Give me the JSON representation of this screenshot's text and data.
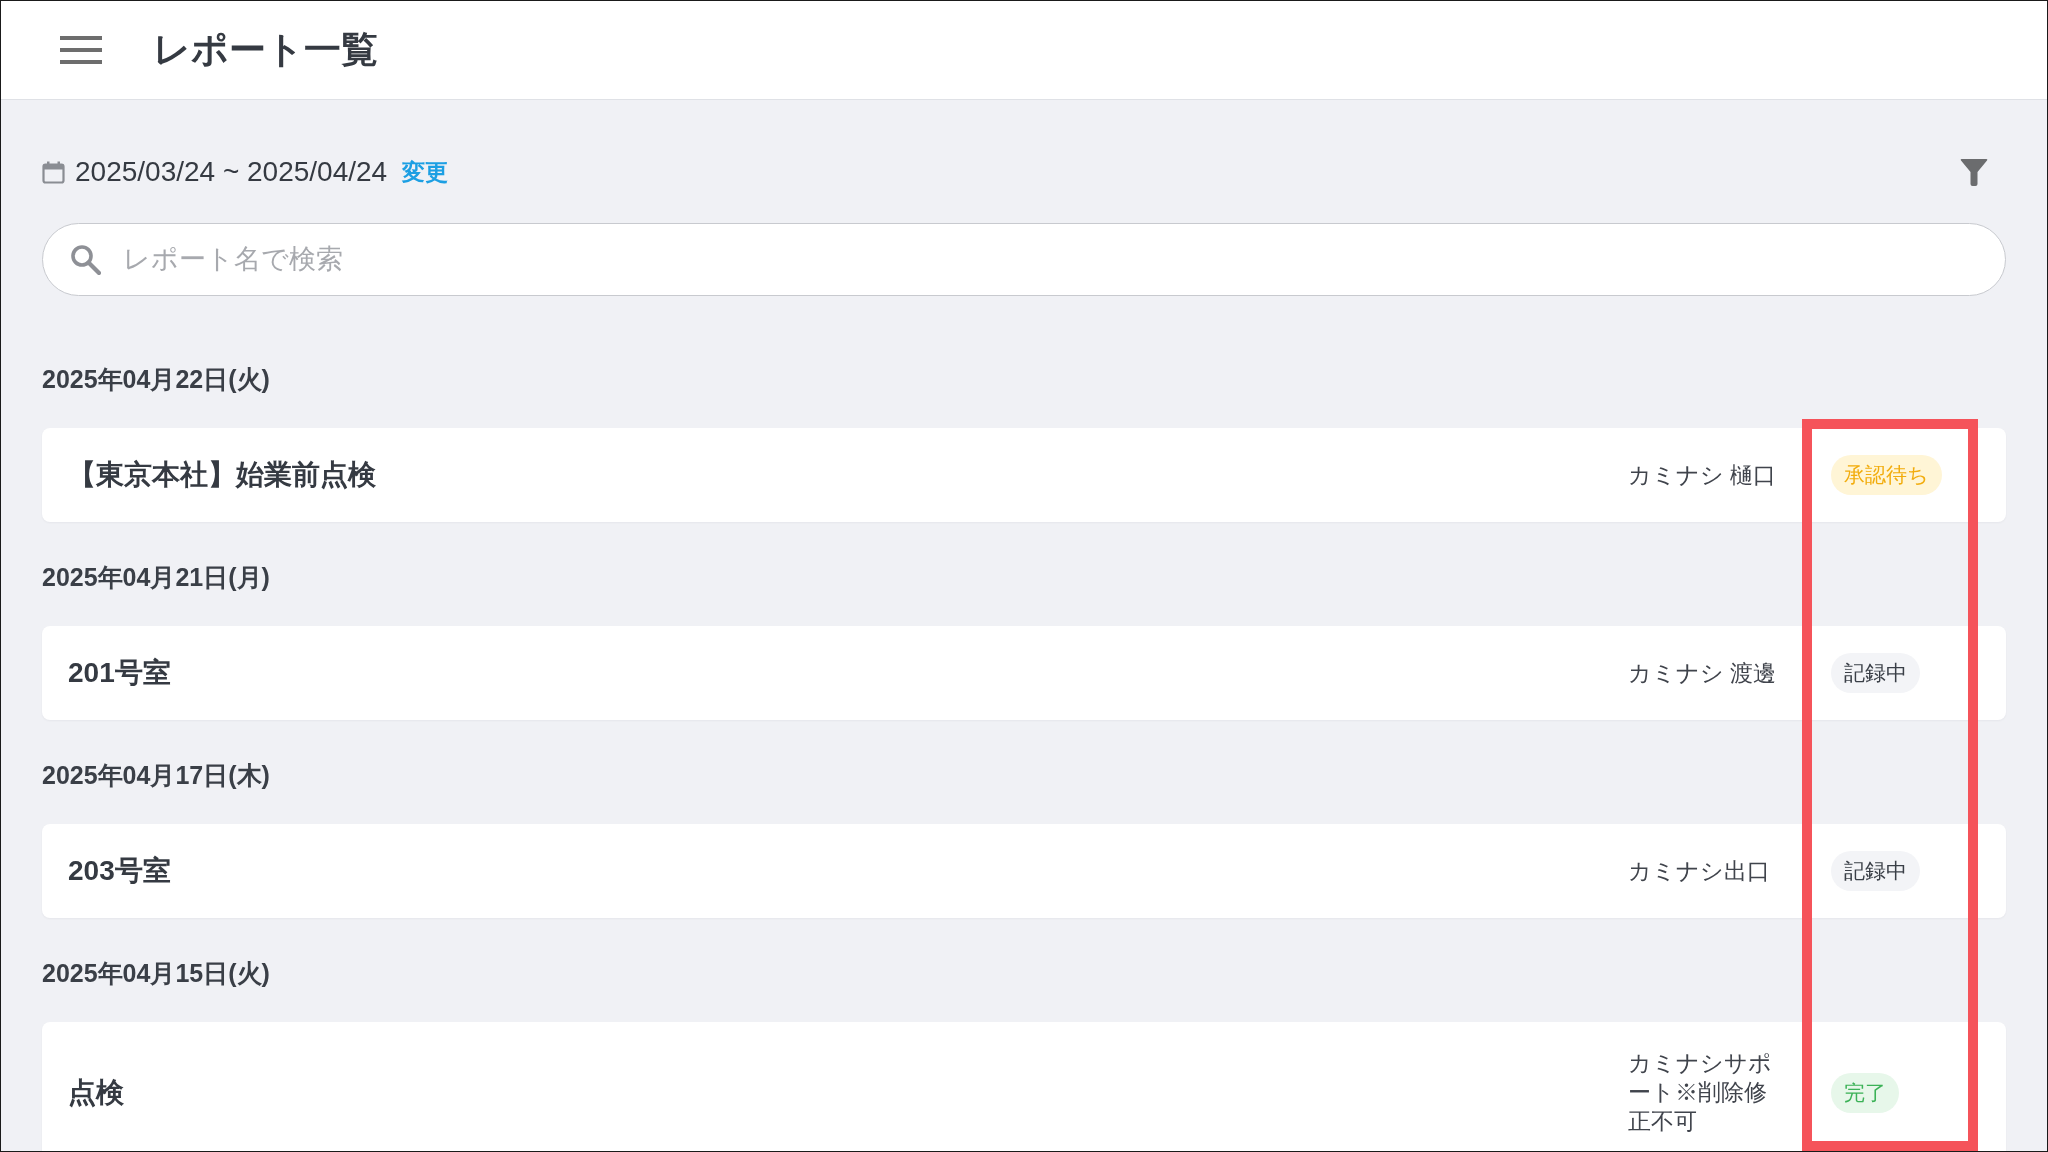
{
  "header": {
    "title": "レポート一覧"
  },
  "period": {
    "range": "2025/03/24 ~ 2025/04/24",
    "change_link": "変更"
  },
  "search": {
    "placeholder": "レポート名で検索"
  },
  "report_groups": [
    {
      "date": "2025年04月22日(火)",
      "reports": [
        {
          "title": "【東京本社】始業前点検",
          "author": "カミナシ 樋口",
          "status": {
            "kind": "pending",
            "label": "承認待ち"
          }
        }
      ]
    },
    {
      "date": "2025年04月21日(月)",
      "reports": [
        {
          "title": "201号室",
          "author": "カミナシ 渡邊",
          "status": {
            "kind": "recording",
            "label": "記録中"
          }
        }
      ]
    },
    {
      "date": "2025年04月17日(木)",
      "reports": [
        {
          "title": "203号室",
          "author": "カミナシ出口",
          "status": {
            "kind": "recording",
            "label": "記録中"
          }
        }
      ]
    },
    {
      "date": "2025年04月15日(火)",
      "reports": [
        {
          "title": "点検",
          "author": "カミナシサポート※削除修正不可",
          "status": {
            "kind": "done",
            "label": "完了"
          }
        }
      ]
    }
  ],
  "highlight_status_column": true
}
